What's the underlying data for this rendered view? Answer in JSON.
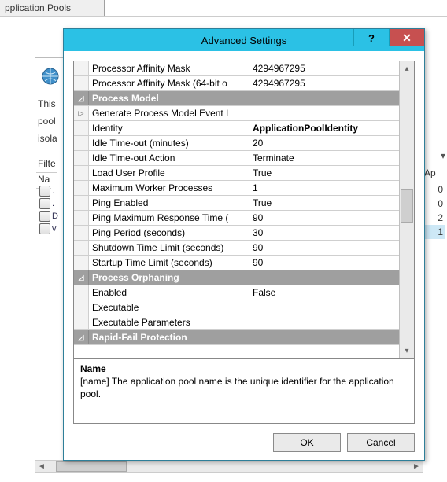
{
  "background": {
    "tab_label": "pplication Pools",
    "left_labels": {
      "this": "This",
      "pool": "pool",
      "isol": "isola",
      "filte": "Filte",
      "na": "Na"
    },
    "left_items": [
      ".",
      ".",
      "D",
      "v"
    ],
    "right_header": "Ap",
    "right_values": [
      "0",
      "0",
      "2",
      "1"
    ]
  },
  "modal": {
    "title": "Advanced Settings",
    "help_label": "?",
    "close_label": "✕",
    "description": {
      "name": "Name",
      "text": "[name] The application pool name is the unique identifier for the application pool."
    },
    "buttons": {
      "ok": "OK",
      "cancel": "Cancel"
    }
  },
  "grid": {
    "rows": [
      {
        "kind": "prop",
        "name": "Processor Affinity Mask",
        "value": "4294967295"
      },
      {
        "kind": "prop",
        "name": "Processor Affinity Mask (64-bit o",
        "value": "4294967295"
      },
      {
        "kind": "cat",
        "name": "Process Model"
      },
      {
        "kind": "expander",
        "name": "Generate Process Model Event L",
        "value": ""
      },
      {
        "kind": "prop",
        "name": "Identity",
        "value": "ApplicationPoolIdentity",
        "bold": true
      },
      {
        "kind": "prop",
        "name": "Idle Time-out (minutes)",
        "value": "20"
      },
      {
        "kind": "prop",
        "name": "Idle Time-out Action",
        "value": "Terminate"
      },
      {
        "kind": "prop",
        "name": "Load User Profile",
        "value": "True"
      },
      {
        "kind": "prop",
        "name": "Maximum Worker Processes",
        "value": "1"
      },
      {
        "kind": "prop",
        "name": "Ping Enabled",
        "value": "True"
      },
      {
        "kind": "prop",
        "name": "Ping Maximum Response Time (",
        "value": "90"
      },
      {
        "kind": "prop",
        "name": "Ping Period (seconds)",
        "value": "30"
      },
      {
        "kind": "prop",
        "name": "Shutdown Time Limit (seconds)",
        "value": "90"
      },
      {
        "kind": "prop",
        "name": "Startup Time Limit (seconds)",
        "value": "90"
      },
      {
        "kind": "cat",
        "name": "Process Orphaning"
      },
      {
        "kind": "prop",
        "name": "Enabled",
        "value": "False"
      },
      {
        "kind": "prop",
        "name": "Executable",
        "value": ""
      },
      {
        "kind": "prop",
        "name": "Executable Parameters",
        "value": ""
      },
      {
        "kind": "cat",
        "name": "Rapid-Fail Protection"
      }
    ]
  }
}
